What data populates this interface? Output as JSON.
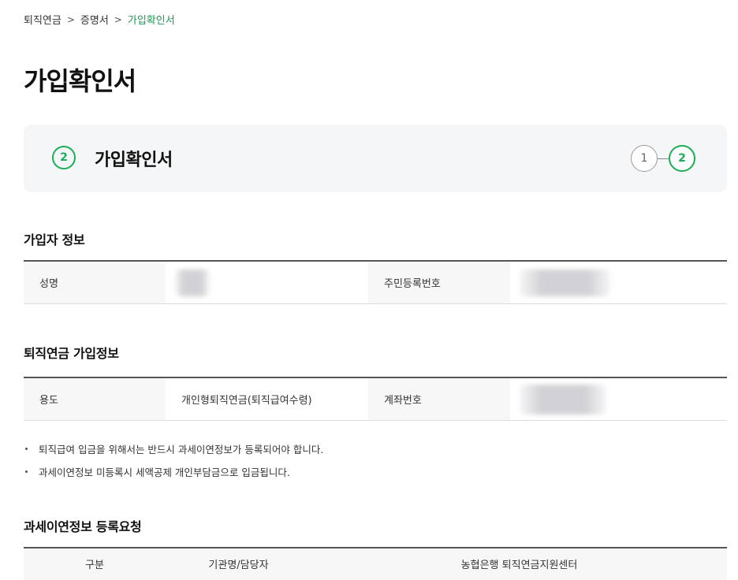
{
  "breadcrumb": {
    "items": [
      "퇴직연금",
      "증명서",
      "가입확인서"
    ],
    "separator": ">"
  },
  "page_title": "가입확인서",
  "step_box": {
    "current_number": "2",
    "title": "가입확인서",
    "steps": [
      "1",
      "2"
    ],
    "active_step": "2"
  },
  "member_info": {
    "title": "가입자 정보",
    "name_label": "성명",
    "name_value": "",
    "rrn_label": "주민등록번호",
    "rrn_value": ""
  },
  "pension_info": {
    "title": "퇴직연금 가입정보",
    "purpose_label": "용도",
    "purpose_value": "개인형퇴직연금(퇴직급여수령)",
    "account_label": "계좌번호",
    "account_value": ""
  },
  "notes": [
    "퇴직급여 입금을 위해서는 반드시 과세이연정보가 등록되어야 합니다.",
    "과세이연정보 미등록시 세액공제 개인부담금으로 입금됩니다."
  ],
  "registration": {
    "title": "과세이연정보 등록요청",
    "columns": [
      "구분",
      "기관명/담당자",
      "농협은행 퇴직연금지원센터"
    ]
  },
  "colors": {
    "accent": "#1aae55",
    "breadcrumb_active": "#1a9a52",
    "panel_bg": "#f5f6f7",
    "header_cell_bg": "#f7f7f7"
  }
}
